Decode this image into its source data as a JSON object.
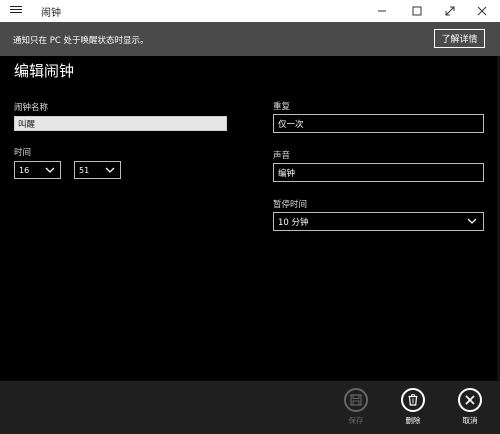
{
  "titlebar": {
    "app_title": "闹钟",
    "icons": [
      "hamburger-icon",
      "minimize-icon",
      "maximize-icon",
      "expand-icon",
      "close-icon"
    ]
  },
  "notification": {
    "text": "通知只在 PC 处于唤醒状态时显示。",
    "button_label": "了解详情"
  },
  "page": {
    "title": "编辑闹钟"
  },
  "form": {
    "name_label": "闹钟名称",
    "name_value": "叫醒",
    "time_label": "时间",
    "hour_value": "16",
    "minute_value": "51",
    "repeat_label": "重复",
    "repeat_value": "仅一次",
    "sound_label": "声音",
    "sound_value": "编钟",
    "snooze_label": "暂停时间",
    "snooze_value": "10 分钟"
  },
  "commands": {
    "save_label": "保存",
    "delete_label": "删除",
    "cancel_label": "取消"
  },
  "colors": {
    "background": "#000000",
    "notification_bar": "#4a4a4a",
    "command_bar": "#1f1f1f"
  }
}
